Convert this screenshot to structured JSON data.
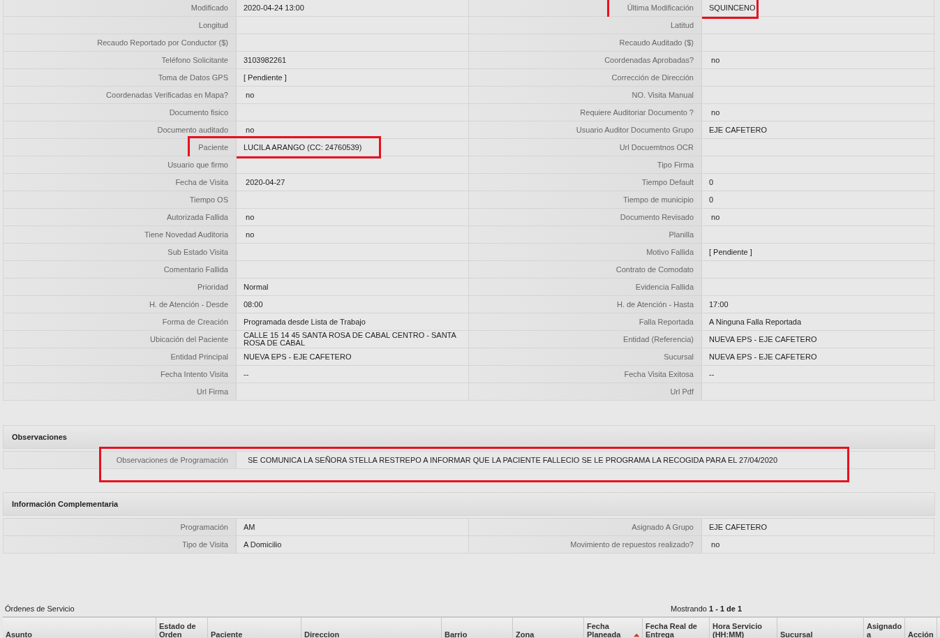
{
  "details": {
    "rows": [
      {
        "left": {
          "label": "Modificado",
          "value": "2020-04-24 13:00"
        },
        "right": {
          "label": "Última Modificación",
          "value": "SQUINCENO",
          "highlighted": true
        }
      },
      {
        "left": {
          "label": "Longitud"
        },
        "right": {
          "label": "Latitud"
        }
      },
      {
        "left": {
          "label": "Recaudo Reportado por Conductor ($)"
        },
        "right": {
          "label": "Recaudo Auditado ($)"
        }
      },
      {
        "left": {
          "label": "Teléfono Solicitante",
          "value": "3103982261"
        },
        "right": {
          "label": "Coordenadas Aprobadas?",
          "value": " no"
        }
      },
      {
        "left": {
          "label": "Toma de Datos GPS",
          "value": "[ Pendiente ]"
        },
        "right": {
          "label": "Corrección de Dirección"
        }
      },
      {
        "left": {
          "label": "Coordenadas Verificadas en Mapa?",
          "value": " no"
        },
        "right": {
          "label": "NO. Visita Manual"
        }
      },
      {
        "left": {
          "label": "Documento fisico"
        },
        "right": {
          "label": "Requiere Auditoriar Documento ?",
          "value": " no"
        }
      },
      {
        "left": {
          "label": "Documento auditado",
          "value": " no"
        },
        "right": {
          "label": "Usuario Auditor Documento Grupo",
          "value": "EJE CAFETERO"
        }
      },
      {
        "left": {
          "label": "Paciente",
          "value": "LUCILA ARANGO (CC: 24760539)",
          "highlighted": true
        },
        "right": {
          "label": "Url Docuemtnos OCR"
        }
      },
      {
        "left": {
          "label": "Usuario que firmo"
        },
        "right": {
          "label": "Tipo Firma"
        }
      },
      {
        "left": {
          "label": "Fecha de Visita",
          "value": " 2020-04-27"
        },
        "right": {
          "label": "Tiempo Default",
          "value": "0"
        }
      },
      {
        "left": {
          "label": "Tiempo OS"
        },
        "right": {
          "label": "Tiempo de municipio",
          "value": "0"
        }
      },
      {
        "left": {
          "label": "Autorizada Fallida",
          "value": " no"
        },
        "right": {
          "label": "Documento Revisado",
          "value": " no"
        }
      },
      {
        "left": {
          "label": "Tiene Novedad Auditoria",
          "value": " no"
        },
        "right": {
          "label": "Planilla"
        }
      },
      {
        "left": {
          "label": "Sub Estado Visita"
        },
        "right": {
          "label": "Motivo Fallida",
          "value": "[ Pendiente ]"
        }
      },
      {
        "left": {
          "label": "Comentario Fallida"
        },
        "right": {
          "label": "Contrato de Comodato"
        }
      },
      {
        "left": {
          "label": "Prioridad",
          "value": "Normal"
        },
        "right": {
          "label": "Evidencia Fallida"
        }
      },
      {
        "left": {
          "label": "H. de Atención - Desde",
          "value": "08:00"
        },
        "right": {
          "label": "H. de Atención - Hasta",
          "value": "17:00"
        }
      },
      {
        "left": {
          "label": "Forma de Creación",
          "value": "Programada desde Lista de Trabajo"
        },
        "right": {
          "label": "Falla Reportada",
          "value": "A Ninguna Falla Reportada"
        }
      },
      {
        "left": {
          "label": "Ubicación del Paciente",
          "value": "CALLE 15 14 45 SANTA ROSA DE CABAL CENTRO - SANTA ROSA DE CABAL"
        },
        "right": {
          "label": "Entidad (Referencia)",
          "value": "NUEVA EPS - EJE CAFETERO"
        }
      },
      {
        "left": {
          "label": "Entidad Principal",
          "value": "NUEVA EPS - EJE CAFETERO"
        },
        "right": {
          "label": "Sucursal",
          "value": "NUEVA EPS - EJE CAFETERO"
        }
      },
      {
        "left": {
          "label": "Fecha Intento Visita",
          "value": "--"
        },
        "right": {
          "label": "Fecha Visita Exitosa",
          "value": "--"
        }
      },
      {
        "left": {
          "label": "Url Firma"
        },
        "right": {
          "label": "Url Pdf"
        }
      }
    ]
  },
  "observaciones": {
    "title": "Observaciones",
    "label": "Observaciones de Programación",
    "value": "SE COMUNICA LA SEÑORA STELLA RESTREPO A INFORMAR QUE LA PACIENTE FALLECIO SE LE PROGRAMA LA RECOGIDA PARA EL 27/04/2020",
    "highlighted": true
  },
  "complementaria": {
    "title": "Información Complementaria",
    "rows": [
      {
        "left": {
          "label": "Programación",
          "value": "AM"
        },
        "right": {
          "label": "Asignado A Grupo",
          "value": "EJE CAFETERO"
        }
      },
      {
        "left": {
          "label": "Tipo de Visita",
          "value": "A Domicilio"
        },
        "right": {
          "label": "Movimiento de repuestos realizado?",
          "value": " no"
        }
      }
    ]
  },
  "ordenes": {
    "title": "Órdenes de Servicio",
    "paging": "Mostrando **1 - 1 de 1**",
    "columns": [
      {
        "label": "Asunto"
      },
      {
        "label": "Estado de Orden"
      },
      {
        "label": "Paciente"
      },
      {
        "label": "Direccion"
      },
      {
        "label": "Barrio"
      },
      {
        "label": "Zona"
      },
      {
        "label": "Fecha Planeada",
        "sorted": true
      },
      {
        "label": "Fecha Real de Entrega"
      },
      {
        "label": "Hora Servicio (HH:MM)"
      },
      {
        "label": "Sucursal"
      },
      {
        "label": "Asignado a"
      },
      {
        "label": "Acción"
      }
    ]
  }
}
